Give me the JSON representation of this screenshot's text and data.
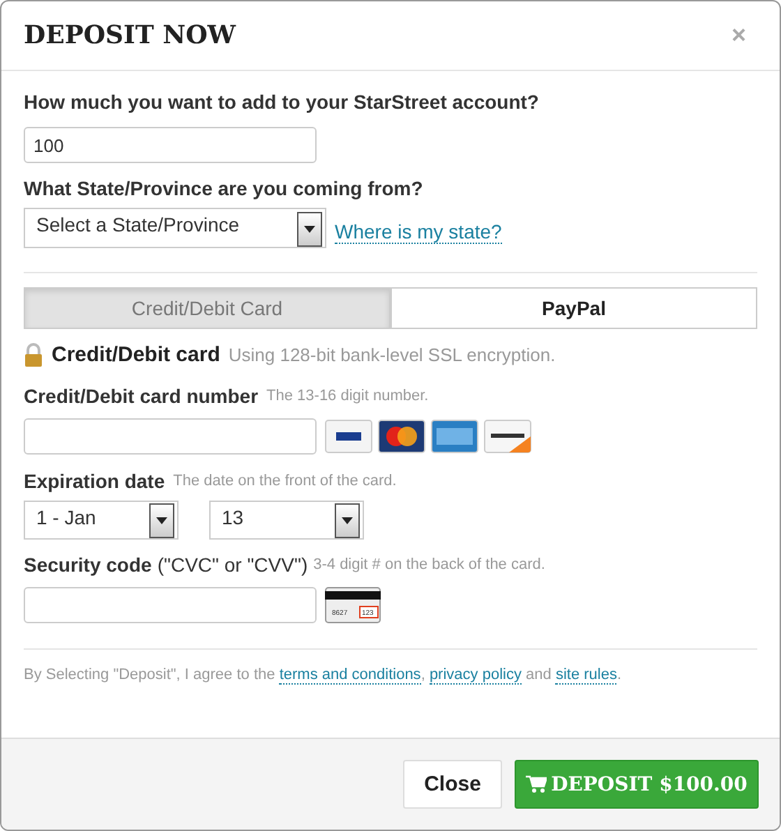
{
  "dialog": {
    "title": "DEPOSIT NOW",
    "close_glyph": "×"
  },
  "amount": {
    "label": "How much you want to add to your StarStreet account?",
    "value": "100"
  },
  "state": {
    "label": "What State/Province are you coming from?",
    "value": "Select a State/Province",
    "help_link": "Where is my state?"
  },
  "tabs": [
    {
      "label": "Credit/Debit Card",
      "selected": true
    },
    {
      "label": "PayPal",
      "selected": false
    }
  ],
  "secure": {
    "title": "Credit/Debit card",
    "note": "Using 128-bit bank-level SSL encryption."
  },
  "card_number": {
    "label": "Credit/Debit card number",
    "hint": "The 13-16 digit number.",
    "cards": [
      {
        "kind": "visa"
      },
      {
        "kind": "mastercard"
      },
      {
        "kind": "amex"
      },
      {
        "kind": "discover"
      }
    ]
  },
  "expiration": {
    "label": "Expiration date",
    "hint": "The date on the front of the card.",
    "month": "1 - Jan",
    "year": "13"
  },
  "security": {
    "label": "Security code",
    "label_extra": "(\"CVC\" or \"CVV\")",
    "hint": "3-4 digit # on the back of the card.",
    "card_digits": "8627",
    "cvv_digits": "123"
  },
  "agreement": [
    {
      "kind": "text",
      "text": "By Selecting \"Deposit\", I agree to the "
    },
    {
      "kind": "link",
      "text": "terms and conditions"
    },
    {
      "kind": "text",
      "text": ", "
    },
    {
      "kind": "link",
      "text": "privacy policy"
    },
    {
      "kind": "text",
      "text": " and "
    },
    {
      "kind": "link",
      "text": "site rules"
    },
    {
      "kind": "text",
      "text": "."
    }
  ],
  "footer": {
    "close": "Close",
    "deposit": "DEPOSIT $100.00"
  }
}
